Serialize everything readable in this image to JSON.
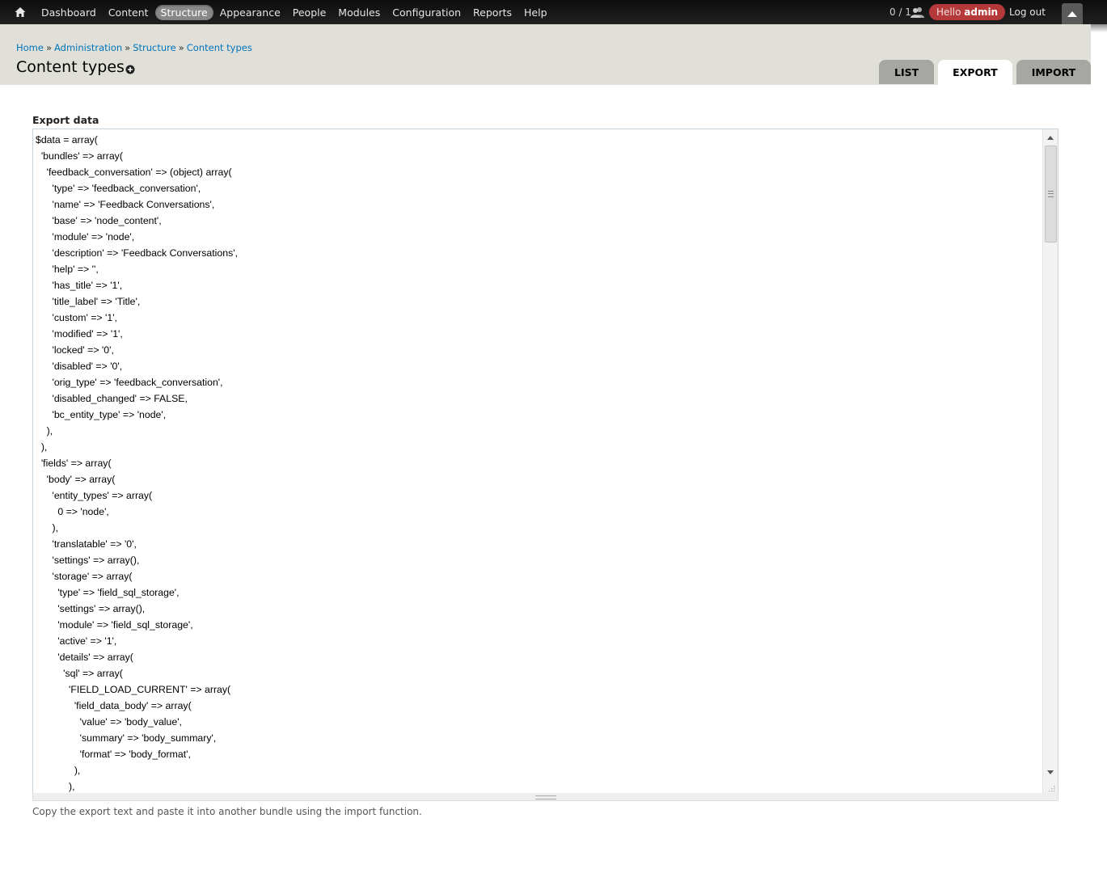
{
  "toolbar": {
    "menu": [
      {
        "label": "Dashboard",
        "active": false
      },
      {
        "label": "Content",
        "active": false
      },
      {
        "label": "Structure",
        "active": true
      },
      {
        "label": "Appearance",
        "active": false
      },
      {
        "label": "People",
        "active": false
      },
      {
        "label": "Modules",
        "active": false
      },
      {
        "label": "Configuration",
        "active": false
      },
      {
        "label": "Reports",
        "active": false
      },
      {
        "label": "Help",
        "active": false
      }
    ],
    "user_counter": "0 / 1",
    "hello_prefix": "Hello",
    "username": "admin",
    "logout_label": "Log out",
    "icons": {
      "home": "home-icon",
      "users": "users-icon",
      "drawer": "drawer-toggle-icon"
    }
  },
  "breadcrumb": [
    {
      "label": "Home"
    },
    {
      "label": "Administration"
    },
    {
      "label": "Structure"
    },
    {
      "label": "Content types"
    }
  ],
  "breadcrumb_separator": "»",
  "page_title": "Content types",
  "tabs": [
    {
      "label": "LIST",
      "active": false
    },
    {
      "label": "EXPORT",
      "active": true
    },
    {
      "label": "IMPORT",
      "active": false
    }
  ],
  "export": {
    "label": "Export data",
    "code_lines": [
      "$data = array(",
      "  'bundles' => array(",
      "    'feedback_conversation' => (object) array(",
      "      'type' => 'feedback_conversation',",
      "      'name' => 'Feedback Conversations',",
      "      'base' => 'node_content',",
      "      'module' => 'node',",
      "      'description' => 'Feedback Conversations',",
      "      'help' => '',",
      "      'has_title' => '1',",
      "      'title_label' => 'Title',",
      "      'custom' => '1',",
      "      'modified' => '1',",
      "      'locked' => '0',",
      "      'disabled' => '0',",
      "      'orig_type' => 'feedback_conversation',",
      "      'disabled_changed' => FALSE,",
      "      'bc_entity_type' => 'node',",
      "    ),",
      "  ),",
      "  'fields' => array(",
      "    'body' => array(",
      "      'entity_types' => array(",
      "        0 => 'node',",
      "      ),",
      "      'translatable' => '0',",
      "      'settings' => array(),",
      "      'storage' => array(",
      "        'type' => 'field_sql_storage',",
      "        'settings' => array(),",
      "        'module' => 'field_sql_storage',",
      "        'active' => '1',",
      "        'details' => array(",
      "          'sql' => array(",
      "            'FIELD_LOAD_CURRENT' => array(",
      "              'field_data_body' => array(",
      "                'value' => 'body_value',",
      "                'summary' => 'body_summary',",
      "                'format' => 'body_format',",
      "              ),",
      "            ),"
    ],
    "description": "Copy the export text and paste it into another bundle using the import function."
  },
  "colors": {
    "toolbar_bg": "#1a1a1a",
    "header_bg": "#e0e0d8",
    "link": "#0074bd",
    "hello_bg": "#b63939",
    "tab_inactive": "#a6a7a2"
  }
}
